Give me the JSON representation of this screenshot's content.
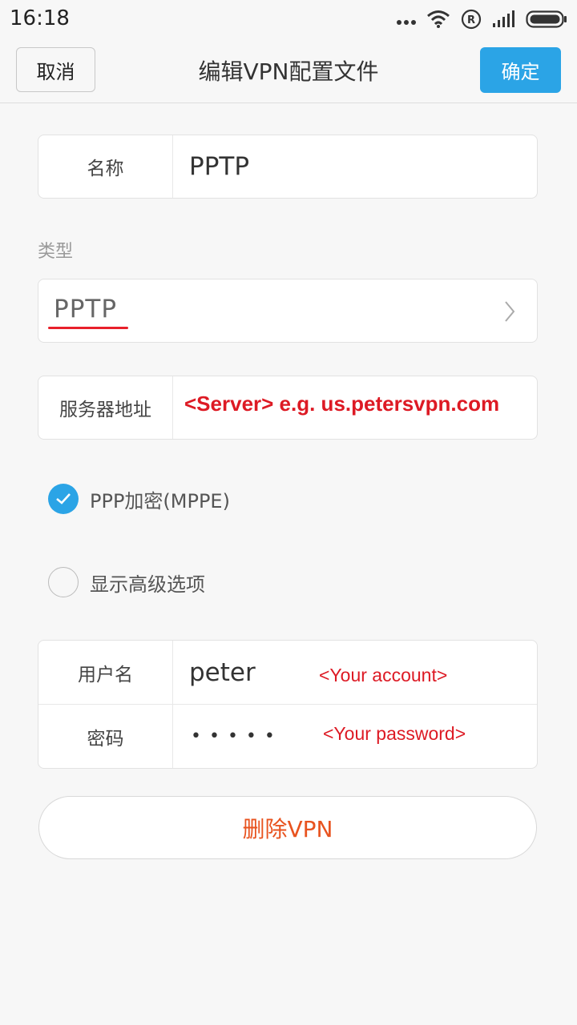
{
  "status_bar": {
    "time": "16:18",
    "icons": [
      "more-dots-icon",
      "wifi-icon",
      "registered-icon",
      "signal-icon",
      "battery-icon"
    ]
  },
  "header": {
    "cancel_label": "取消",
    "title": "编辑VPN配置文件",
    "ok_label": "确定"
  },
  "fields": {
    "name_label": "名称",
    "name_value": "PPTP",
    "type_section_label": "类型",
    "type_value": "PPTP",
    "server_label": "服务器地址",
    "server_annotation": "<Server> e.g. us.petersvpn.com"
  },
  "options": {
    "mppe_label": "PPP加密(MPPE)",
    "mppe_checked": true,
    "advanced_label": "显示高级选项",
    "advanced_checked": false
  },
  "credentials": {
    "username_label": "用户名",
    "username_value": "peter",
    "username_annotation": "<Your account>",
    "password_label": "密码",
    "password_value": "•••••",
    "password_annotation": "<Your password>"
  },
  "delete_button_label": "删除VPN",
  "colors": {
    "accent": "#2ba4e6",
    "danger_text": "#e8531f",
    "annotation": "#dd1a24"
  }
}
